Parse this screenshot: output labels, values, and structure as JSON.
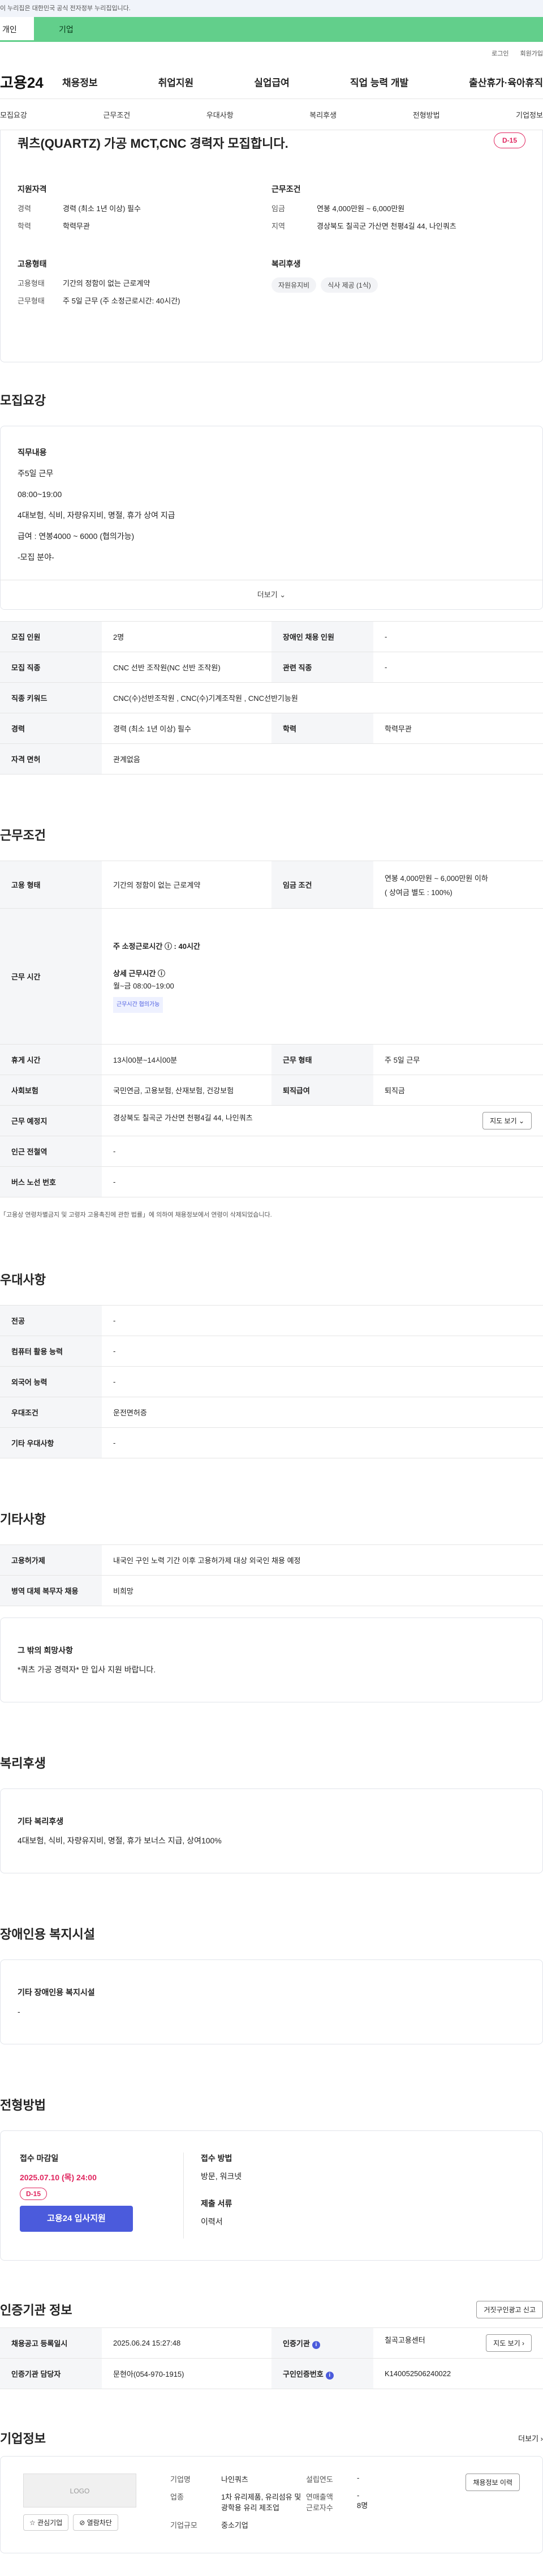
{
  "notice": "이 누리집은 대한민국 공식 전자정부 누리집입니다.",
  "top_tabs": [
    "개인",
    "기업"
  ],
  "util_links": [
    "로그인",
    "회원가입"
  ],
  "logo": "고용24",
  "gnb": [
    "채용정보",
    "취업지원",
    "실업급여",
    "직업 능력 개발",
    "출산휴가·육아휴직"
  ],
  "subnav": [
    "모집요강",
    "근무조건",
    "우대사항",
    "복리후생",
    "전형방법",
    "기업정보"
  ],
  "job": {
    "title": "쿼츠(QUARTZ) 가공 MCT,CNC 경력자 모집합니다.",
    "dday": "D-15",
    "qual_title": "지원자격",
    "career_k": "경력",
    "career_v": "경력 (최소 1년 이상) 필수",
    "edu_k": "학력",
    "edu_v": "학력무관",
    "work_title": "근무조건",
    "wage_k": "임금",
    "wage_v": "연봉 4,000만원 ~ 6,000만원",
    "region_k": "지역",
    "region_v": "경상북도 칠곡군 가산면 천평4길 44, 나인쿼츠",
    "emp_title": "고용형태",
    "emptype_k": "고용형태",
    "emptype_v": "기간의 정함이 없는 근로계약",
    "worktype_k": "근무형태",
    "worktype_v": "주 5일 근무 (주 소정근로시간: 40시간)",
    "welfare_title": "복리후생",
    "chips": [
      "자원유지비",
      "식사 제공 (1식)"
    ]
  },
  "recruit": {
    "heading": "모집요강",
    "lines": [
      "직무내용",
      "주5일 근무",
      "08:00~19:00",
      "4대보험, 식비,  자량유지비, 명절, 휴가  상여 지급",
      "급여 : 연봉4000 ~ 6000 (협의가능)",
      "-모집 분야-"
    ],
    "more": "더보기 ⌄",
    "table": {
      "r1": [
        "모집 인원",
        "2명",
        "장애인 채용 인원",
        "-"
      ],
      "r2": [
        "모집 직종",
        "CNC 선반 조작원(NC 선반 조작원)",
        "관련 직종",
        "-"
      ],
      "r3": [
        "직종 키워드",
        "CNC(수)선반조작원 , CNC(수)기계조작원 , CNC선반기능원"
      ],
      "r4": [
        "경력",
        "경력 (최소 1년 이상) 필수",
        "학력",
        "학력무관"
      ],
      "r5": [
        "자격 면허",
        "관계없음"
      ]
    }
  },
  "cond": {
    "heading": "근무조건",
    "r1": [
      "고용 형태",
      "기간의 정함이 없는 근로계약",
      "임금 조건",
      "연봉 4,000만원 ~ 6,000만원 이하",
      "( 상여금 별도 : 100%)"
    ],
    "time_k": "근무 시간",
    "time_main": "주 소정근로시간 ⓘ : 40시간",
    "time_detail_h": "상세 근무시간 ⓘ",
    "time_detail": "월~금 08:00~19:00",
    "time_tag": "근무시간 협의가능",
    "r3": [
      "휴게 시간",
      "13시00분~14시00분",
      "근무 형태",
      "주 5일 근무"
    ],
    "r4": [
      "사회보험",
      "국민연금, 고용보험, 산재보험, 건강보험",
      "퇴직급여",
      "퇴직금"
    ],
    "r5": [
      "근무 예정지",
      "경상북도 칠곡군 가산면 천평4길 44, 나인쿼츠"
    ],
    "map_btn": "지도 보기 ⌄",
    "r6": [
      "인근 전철역",
      "-"
    ],
    "r7": [
      "버스 노선 번호",
      "-"
    ],
    "note": "「고용상 연령차별금지 및 고령자 고용촉진에 관한 법률」에 의하여 채용정보에서 연령이 삭제되었습니다."
  },
  "pref": {
    "heading": "우대사항",
    "rows": [
      [
        "전공",
        "-"
      ],
      [
        "컴퓨터 활용 능력",
        "-"
      ],
      [
        "외국어 능력",
        "-"
      ],
      [
        "우대조건",
        "운전면허증"
      ],
      [
        "기타 우대사항",
        "-"
      ]
    ]
  },
  "etc": {
    "heading": "기타사항",
    "rows": [
      [
        "고용허가제",
        "내국인 구인 노력 기간 이후 고용허가제 대상 외국인 채용 예정"
      ],
      [
        "병역 대체 복무자 채용",
        "비희망"
      ]
    ],
    "talent_h": "그 밖의 희망사항",
    "talent_v": "*쿼츠 가공 경력자* 만 입사 지원 바랍니다."
  },
  "welfare": {
    "heading": "복리후생",
    "h": "기타 복리후생",
    "v": "4대보험, 식비,  자량유지비, 명절, 휴가 보너스 지급, 상여100%"
  },
  "disabled": {
    "heading": "장애인용 복지시설",
    "h": "기타 장애인용 복지시설",
    "v": "-"
  },
  "apply": {
    "heading": "전형방법",
    "deadline_h": "접수 마감일",
    "deadline": "2025.07.10 (목) 24:00",
    "dday": "D-15",
    "btn": "고용24 입사지원",
    "method_h": "접수 방법",
    "method": "방문, 워크넷",
    "docs_h": "제출 서류",
    "docs": "이력서"
  },
  "agency": {
    "heading": "인증기관 정보",
    "report": "거짓구인광고 신고",
    "r1": [
      "채용공고 등록일시",
      "2025.06.24 15:27:48",
      "인증기관",
      "칠곡고용센터"
    ],
    "map_btn": "지도 보기 ›",
    "r2": [
      "인증기관 담당자",
      "문현아(054-970-1915)",
      "구인인증번호",
      "K140052506240022"
    ]
  },
  "company": {
    "heading": "기업정보",
    "more": "더보기 ›",
    "logo": "LOGO",
    "fav": "☆ 관심기업",
    "block": "⊘ 열람차단",
    "name_k": "기업명",
    "name_v": "나인쿼츠",
    "year_k": "설립연도",
    "year_v": "-",
    "ind_k": "업종",
    "ind_v": "1차 유리제품, 유리섬유 및 광학용 유리 제조업",
    "sales_k": "연매출액",
    "sales_v": "-",
    "emp_k": "근로자수",
    "emp_v": "8명",
    "size_k": "기업규모",
    "size_v": "중소기업",
    "history_btn": "채용정보 이력"
  }
}
